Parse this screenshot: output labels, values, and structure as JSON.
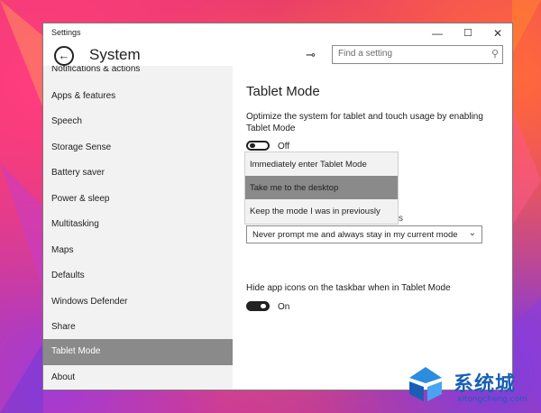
{
  "window": {
    "title": "Settings",
    "controls": {
      "minimize": "—",
      "maximize": "☐",
      "close": "✕"
    }
  },
  "header": {
    "back_icon": "←",
    "title": "System",
    "pin_icon": "⊸",
    "search": {
      "placeholder": "Find a setting",
      "icon": "⚲"
    }
  },
  "sidebar": {
    "items": [
      {
        "label": "Notifications & actions",
        "selected": false
      },
      {
        "label": "Apps & features",
        "selected": false
      },
      {
        "label": "Speech",
        "selected": false
      },
      {
        "label": "Storage Sense",
        "selected": false
      },
      {
        "label": "Battery saver",
        "selected": false
      },
      {
        "label": "Power & sleep",
        "selected": false
      },
      {
        "label": "Multitasking",
        "selected": false
      },
      {
        "label": "Maps",
        "selected": false
      },
      {
        "label": "Defaults",
        "selected": false
      },
      {
        "label": "Windows Defender",
        "selected": false
      },
      {
        "label": "Share",
        "selected": false
      },
      {
        "label": "Tablet Mode",
        "selected": true
      },
      {
        "label": "About",
        "selected": false
      }
    ]
  },
  "content": {
    "title": "Tablet Mode",
    "description": "Optimize the system for tablet and touch usage by enabling Tablet Mode",
    "tablet_toggle": {
      "state": "Off"
    },
    "signin_popup": {
      "options": [
        "Immediately enter Tablet Mode",
        "Take me to the desktop",
        "Keep the mode I was in previously"
      ],
      "highlighted": 1
    },
    "obscured_label_tail": "s",
    "prompt_dropdown": {
      "value": "Never prompt me and always stay in my current mode",
      "chevron": "⌄"
    },
    "hide_icons": {
      "label": "Hide app icons on the taskbar when in Tablet Mode",
      "state": "On"
    }
  },
  "watermark": {
    "text": "系统城",
    "sub": "xitongcheng.com"
  }
}
